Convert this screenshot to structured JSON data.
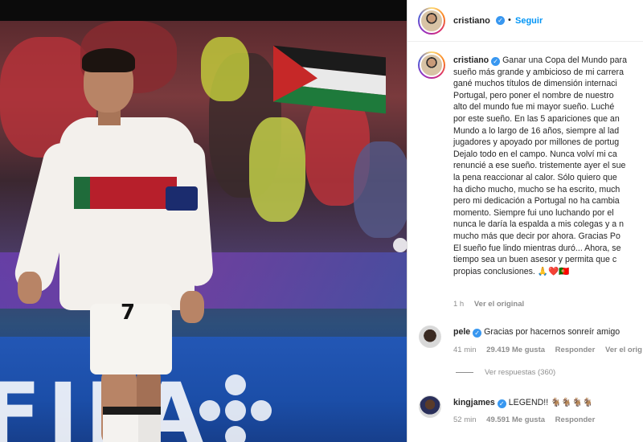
{
  "post": {
    "author": "cristiano",
    "follow_label": "Seguir",
    "separator": "•",
    "caption_lines": [
      "Ganar una Copa del Mundo para",
      "sueño más grande y ambicioso de mi carrera",
      "gané muchos títulos de dimensión internaci",
      "Portugal, pero poner el nombre de nuestro",
      "alto del mundo fue mi mayor sueño. Luché",
      "por este sueño. En las 5 apariciones que an",
      "Mundo a lo largo de 16 años, siempre al lad",
      "jugadores y apoyado por millones de portug",
      "Dejalo todo en el campo. Nunca volví mi ca",
      "renuncié a ese sueño. tristemente ayer el sue",
      "la pena reaccionar al calor. Sólo quiero que",
      "ha dicho mucho, mucho se ha escrito, much",
      "pero mi dedicación a Portugal no ha cambia",
      "momento. Siempre fui uno luchando por el",
      "nunca le daría la espalda a mis colegas y a n",
      "mucho más que decir por ahora. Gracias Po",
      "El sueño fue lindo mientras duró... Ahora, se",
      "tiempo sea un buen asesor y permita que c",
      "propias conclusiones. 🙏❤️🇵🇹"
    ],
    "time_ago": "1 h",
    "see_original": "Ver el original"
  },
  "comments": [
    {
      "user": "pele",
      "text": "Gracias por hacernos sonreír amigo",
      "time": "41 min",
      "likes": "29.419 Me gusta",
      "reply": "Responder",
      "see_original": "Ver el orig",
      "view_replies": "Ver respuestas (360)"
    },
    {
      "user": "kingjames",
      "text": "LEGEND!! 🐐🐐🐐🐐",
      "time": "52 min",
      "likes": "49.591 Me gusta",
      "reply": "Responder"
    }
  ],
  "photo": {
    "ad_text": "FIFA",
    "shirt_number": "7"
  },
  "colors": {
    "link_blue": "#0095f6",
    "verified_blue": "#3897f0",
    "meta_gray": "#8e8e8e"
  }
}
